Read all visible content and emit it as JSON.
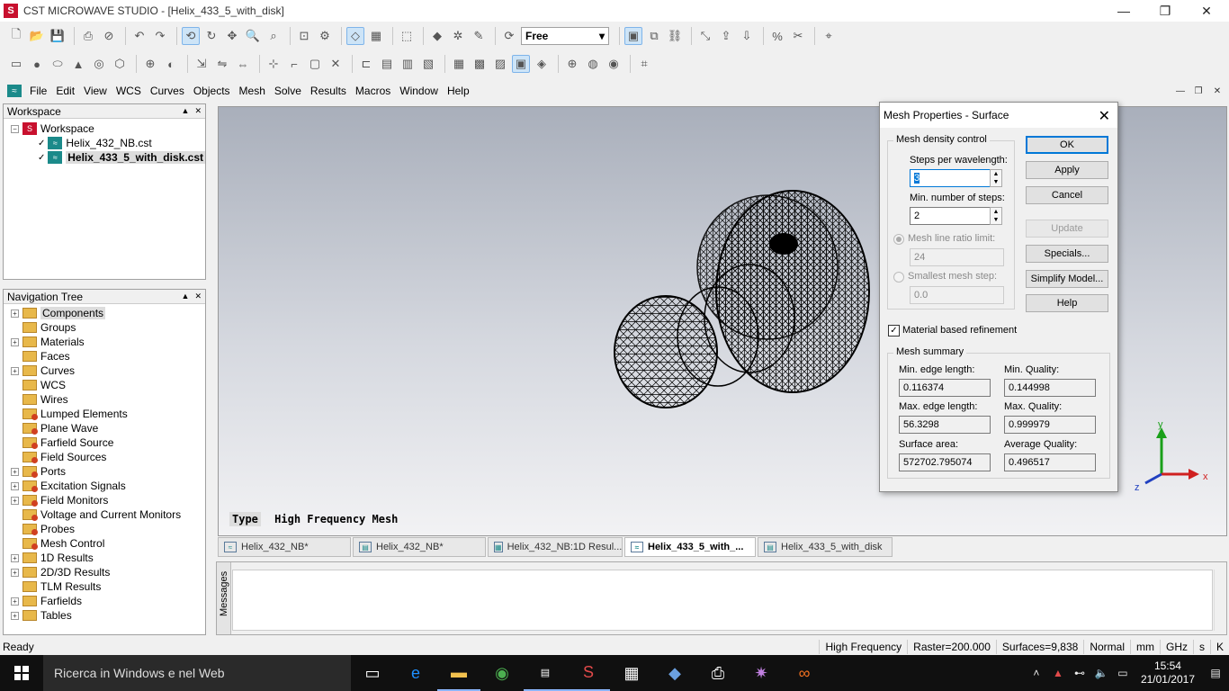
{
  "window": {
    "title": "CST MICROWAVE STUDIO - [Helix_433_5_with_disk]",
    "logo_letter": "S",
    "minimize": "—",
    "restore": "❐",
    "close": "✕"
  },
  "toolbar": {
    "view_mode": "Free"
  },
  "menu": {
    "items": [
      "File",
      "Edit",
      "View",
      "WCS",
      "Curves",
      "Objects",
      "Mesh",
      "Solve",
      "Results",
      "Macros",
      "Window",
      "Help"
    ]
  },
  "workspace": {
    "header": "Workspace",
    "root": "Workspace",
    "files": [
      {
        "name": "Helix_432_NB.cst",
        "selected": false
      },
      {
        "name": "Helix_433_5_with_disk.cst",
        "selected": true
      }
    ]
  },
  "nav_tree": {
    "header": "Navigation Tree",
    "items": [
      {
        "label": "Components",
        "expand": true,
        "red": false
      },
      {
        "label": "Groups",
        "expand": false,
        "red": false
      },
      {
        "label": "Materials",
        "expand": true,
        "red": false
      },
      {
        "label": "Faces",
        "expand": false,
        "red": false
      },
      {
        "label": "Curves",
        "expand": true,
        "red": false
      },
      {
        "label": "WCS",
        "expand": false,
        "red": false
      },
      {
        "label": "Wires",
        "expand": false,
        "red": false
      },
      {
        "label": "Lumped Elements",
        "expand": false,
        "red": true
      },
      {
        "label": "Plane Wave",
        "expand": false,
        "red": true
      },
      {
        "label": "Farfield Source",
        "expand": false,
        "red": true
      },
      {
        "label": "Field Sources",
        "expand": false,
        "red": true
      },
      {
        "label": "Ports",
        "expand": true,
        "red": true
      },
      {
        "label": "Excitation Signals",
        "expand": true,
        "red": true
      },
      {
        "label": "Field Monitors",
        "expand": true,
        "red": true
      },
      {
        "label": "Voltage and Current Monitors",
        "expand": false,
        "red": true
      },
      {
        "label": "Probes",
        "expand": false,
        "red": true
      },
      {
        "label": "Mesh Control",
        "expand": false,
        "red": true
      },
      {
        "label": "1D Results",
        "expand": true,
        "red": false
      },
      {
        "label": "2D/3D Results",
        "expand": true,
        "red": false
      },
      {
        "label": "TLM Results",
        "expand": false,
        "red": false
      },
      {
        "label": "Farfields",
        "expand": true,
        "red": false
      },
      {
        "label": "Tables",
        "expand": true,
        "red": false
      }
    ]
  },
  "viewport": {
    "type_key": "Type",
    "type_value": "High Frequency Mesh",
    "axis_y": "y",
    "axis_z": "z",
    "axis_x": "x"
  },
  "doc_tabs": [
    {
      "label": "Helix_432_NB*",
      "active": false,
      "width": 148
    },
    {
      "label": "Helix_432_NB*",
      "active": false,
      "width": 148
    },
    {
      "label": "Helix_432_NB:1D Resul...",
      "active": false,
      "width": 150
    },
    {
      "label": "Helix_433_5_with_...",
      "active": true,
      "width": 146
    },
    {
      "label": "Helix_433_5_with_disk",
      "active": false,
      "width": 150
    }
  ],
  "messages": {
    "label": "Messages"
  },
  "status": {
    "ready": "Ready",
    "cells": [
      "High Frequency",
      "Raster=200.000",
      "Surfaces=9,838",
      "Normal",
      "mm",
      "GHz",
      "s",
      "K"
    ]
  },
  "dialog": {
    "title": "Mesh Properties - Surface",
    "density_group": "Mesh density control",
    "steps_label": "Steps per wavelength:",
    "steps_value": "3",
    "min_steps_label": "Min. number of steps:",
    "min_steps_value": "2",
    "ratio_label": "Mesh line ratio limit:",
    "ratio_value": "24",
    "smallest_label": "Smallest mesh step:",
    "smallest_value": "0.0",
    "material_refinement": "Material based refinement",
    "summary_group": "Mesh summary",
    "min_edge_label": "Min. edge length:",
    "min_edge_value": "0.116374",
    "min_quality_label": "Min. Quality:",
    "min_quality_value": "0.144998",
    "max_edge_label": "Max. edge length:",
    "max_edge_value": "56.3298",
    "max_quality_label": "Max. Quality:",
    "max_quality_value": "0.999979",
    "surface_label": "Surface area:",
    "surface_value": "572702.795074",
    "avg_quality_label": "Average Quality:",
    "avg_quality_value": "0.496517",
    "ok": "OK",
    "apply": "Apply",
    "cancel": "Cancel",
    "update": "Update",
    "specials": "Specials...",
    "simplify": "Simplify Model...",
    "help": "Help"
  },
  "taskbar": {
    "search_placeholder": "Ricerca in Windows e nel Web",
    "time": "15:54",
    "date": "21/01/2017"
  },
  "colors": {
    "accent": "#0078d7",
    "cst_red": "#c8102e",
    "cst_teal": "#1b8a8a"
  }
}
